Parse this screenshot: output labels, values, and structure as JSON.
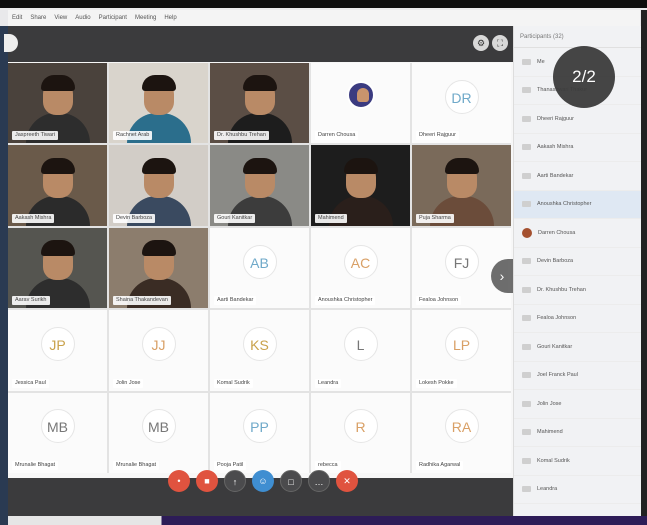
{
  "menu": [
    "Edit",
    "Share",
    "View",
    "Audio",
    "Participant",
    "Meeting",
    "Help"
  ],
  "page_indicator": "2/2",
  "tiles": [
    {
      "name": "Jaspreeth Tiwari",
      "kind": "video",
      "shirt": "#2d2d2d",
      "bg": "#4a423c"
    },
    {
      "name": "Rachnet Arab",
      "kind": "video",
      "shirt": "#2b6e8c",
      "bg": "#d9d4cc"
    },
    {
      "name": "Dr. Khushbu Trehan",
      "kind": "video",
      "shirt": "#1d1d1d",
      "bg": "#5b4e45"
    },
    {
      "name": "Darren Chousa",
      "kind": "photo"
    },
    {
      "name": "Dheeri Rajguur",
      "kind": "initials",
      "initials": "DR",
      "tone": "blue"
    },
    {
      "name": "Aakash Mishra",
      "kind": "video",
      "shirt": "#2b2b2b",
      "bg": "#6a5a4a"
    },
    {
      "name": "Devin Barboza",
      "kind": "video",
      "shirt": "#3a4a60",
      "bg": "#d2cdc7"
    },
    {
      "name": "Gouri Kanitkar",
      "kind": "video",
      "shirt": "#3c3c3c",
      "bg": "#8a8a86"
    },
    {
      "name": "Mahimend",
      "kind": "video",
      "shirt": "#2a1f1b",
      "bg": "#1d1d1d"
    },
    {
      "name": "Puja Sharma",
      "kind": "video",
      "shirt": "#6b4c3a",
      "bg": "#7a6a5a"
    },
    {
      "name": "Aarav Surikh",
      "kind": "video",
      "shirt": "#2d2d2d",
      "bg": "#555550"
    },
    {
      "name": "Shaina Thakandevan",
      "kind": "video",
      "shirt": "#3a2c24",
      "bg": "#8c7d6d"
    },
    {
      "name": "Aarti Bandekar",
      "kind": "initials",
      "initials": "AB",
      "tone": "blue"
    },
    {
      "name": "Anoushka Christopher",
      "kind": "initials",
      "initials": "AC",
      "tone": "orange"
    },
    {
      "name": "Fealoa Johnson",
      "kind": "initials",
      "initials": "FJ",
      "tone": "gray"
    },
    {
      "name": "Jessica Paul",
      "kind": "initials",
      "initials": "JP",
      "tone": "gold"
    },
    {
      "name": "Jolin Jose",
      "kind": "initials",
      "initials": "JJ",
      "tone": "orange"
    },
    {
      "name": "Komal Sudrik",
      "kind": "initials",
      "initials": "KS",
      "tone": "gold"
    },
    {
      "name": "Leandra",
      "kind": "initials",
      "initials": "L",
      "tone": "gray"
    },
    {
      "name": "Lokesh Pokke",
      "kind": "initials",
      "initials": "LP",
      "tone": "orange"
    },
    {
      "name": "Mrunalie Bhagat",
      "kind": "initials",
      "initials": "MB",
      "tone": "gray"
    },
    {
      "name": "Mrunalie Bhagat",
      "kind": "initials",
      "initials": "MB",
      "tone": "gray"
    },
    {
      "name": "Pooja Patil",
      "kind": "initials",
      "initials": "PP",
      "tone": "blue"
    },
    {
      "name": "rebecca",
      "kind": "initials",
      "initials": "R",
      "tone": "orange"
    },
    {
      "name": "Radhika Agarwal",
      "kind": "initials",
      "initials": "RA",
      "tone": "orange"
    }
  ],
  "sidebar": {
    "header": "Participants (32)",
    "items": [
      {
        "name": "Me",
        "photo": false,
        "hl": false
      },
      {
        "name": "Thanashwari Thakur",
        "photo": false,
        "hl": false
      },
      {
        "name": "Dheeri Rajguur",
        "photo": false,
        "hl": false
      },
      {
        "name": "Aakash Mishra",
        "photo": false,
        "hl": false
      },
      {
        "name": "Aarti Bandekar",
        "photo": false,
        "hl": false
      },
      {
        "name": "Anoushka Christopher",
        "photo": false,
        "hl": true
      },
      {
        "name": "Darren Chousa",
        "photo": true,
        "hl": false
      },
      {
        "name": "Devin Barboza",
        "photo": false,
        "hl": false
      },
      {
        "name": "Dr. Khushbu Trehan",
        "photo": false,
        "hl": false
      },
      {
        "name": "Fealoa Johnson",
        "photo": false,
        "hl": false
      },
      {
        "name": "Gouri Kanitkar",
        "photo": false,
        "hl": false
      },
      {
        "name": "Joel Franck Paul",
        "photo": false,
        "hl": false
      },
      {
        "name": "Jolin Jose",
        "photo": false,
        "hl": false
      },
      {
        "name": "Mahimend",
        "photo": false,
        "hl": false
      },
      {
        "name": "Komal Sudrik",
        "photo": false,
        "hl": false
      },
      {
        "name": "Leandra",
        "photo": false,
        "hl": false
      }
    ]
  },
  "controls": [
    {
      "name": "mic-button",
      "glyph": "•",
      "style": "red"
    },
    {
      "name": "video-button",
      "glyph": "■",
      "style": "red"
    },
    {
      "name": "share-button",
      "glyph": "↑",
      "style": "dark"
    },
    {
      "name": "participants-button",
      "glyph": "☺",
      "style": "blue"
    },
    {
      "name": "chat-button",
      "glyph": "□",
      "style": "dark"
    },
    {
      "name": "more-button",
      "glyph": "…",
      "style": "dark"
    },
    {
      "name": "leave-button",
      "glyph": "✕",
      "style": "red"
    }
  ]
}
